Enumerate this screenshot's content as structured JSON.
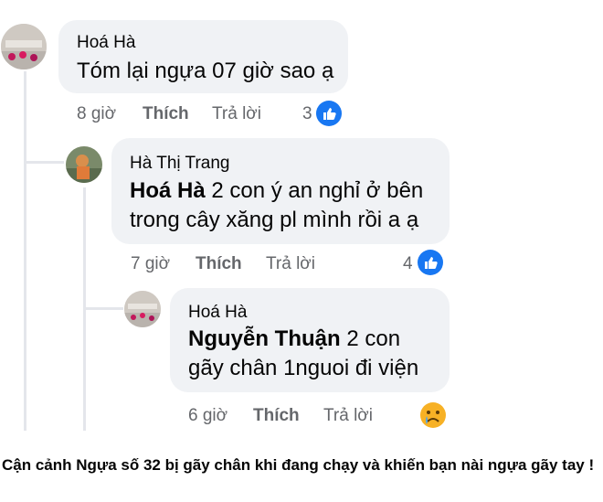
{
  "comments": [
    {
      "author": "Hoá Hà",
      "text": "Tóm lại ngựa 07 giờ sao ạ",
      "time": "8 giờ",
      "like_label": "Thích",
      "reply_label": "Trả lời",
      "reaction_count": "3",
      "reaction_icon": "like-icon"
    },
    {
      "author": "Hà Thị Trang",
      "mention": "Hoá Hà",
      "text_line1": " 2 con ý an nghỉ ở bên",
      "text_line2": "trong cây xăng pl mình rồi a ạ",
      "time": "7 giờ",
      "like_label": "Thích",
      "reply_label": "Trả lời",
      "reaction_count": "4",
      "reaction_icon": "like-icon"
    },
    {
      "author": "Hoá Hà",
      "mention": "Nguyễn Thuận",
      "text_line1": " 2 con",
      "text_line2": "gãy chân 1nguoi đi viện",
      "time": "6 giờ",
      "like_label": "Thích",
      "reply_label": "Trả lời",
      "reaction_icon": "sad-emoji-icon"
    }
  ],
  "caption": "Cận cảnh Ngựa số 32 bị gãy chân khi đang chạy và khiến bạn nài ngựa gãy tay !",
  "colors": {
    "bubble": "#f0f2f5",
    "meta_text": "#65676b",
    "like_blue": "#1877f2",
    "thread_line": "#e4e6eb"
  }
}
